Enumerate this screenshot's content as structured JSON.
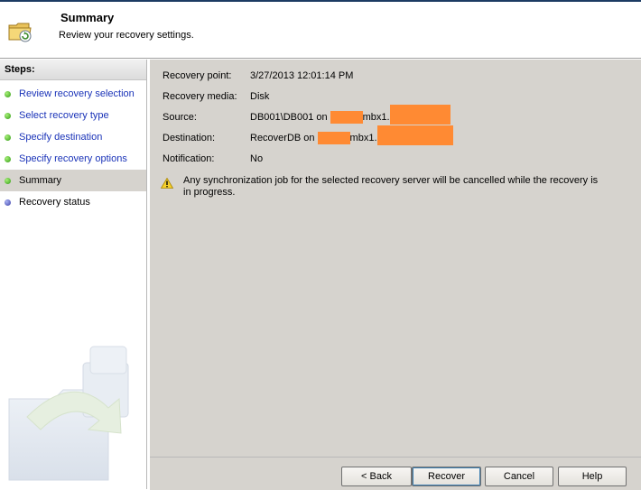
{
  "header": {
    "title": "Summary",
    "subtitle": "Review your recovery settings."
  },
  "sidebar": {
    "steps_label": "Steps:",
    "items": [
      {
        "label": "Review recovery selection",
        "state": "completed"
      },
      {
        "label": "Select recovery type",
        "state": "completed"
      },
      {
        "label": "Specify destination",
        "state": "completed"
      },
      {
        "label": "Specify recovery options",
        "state": "completed"
      },
      {
        "label": "Summary",
        "state": "current"
      },
      {
        "label": "Recovery status",
        "state": "pending"
      }
    ]
  },
  "summary": {
    "recovery_point": {
      "label": "Recovery point:",
      "value": "3/27/2013 12:01:14 PM"
    },
    "recovery_media": {
      "label": "Recovery media:",
      "value": "Disk"
    },
    "source": {
      "label": "Source:",
      "value_prefix": "DB001\\DB001 on",
      "value_mid": "mbx1."
    },
    "destination": {
      "label": "Destination:",
      "value_prefix": "RecoverDB on",
      "value_mid": "mbx1."
    },
    "notification": {
      "label": "Notification:",
      "value": "No"
    }
  },
  "warning": {
    "icon": "warning-icon",
    "text": "Any synchronization job for the selected recovery server will be cancelled while the recovery is in progress."
  },
  "buttons": {
    "back": "< Back",
    "recover": "Recover",
    "cancel": "Cancel",
    "help": "Help"
  },
  "colors": {
    "panel": "#d6d3ce",
    "link": "#1a33b8",
    "redaction": "#ff8a33",
    "step_done": "#2f9a12",
    "step_pending": "#3b3fa8"
  }
}
